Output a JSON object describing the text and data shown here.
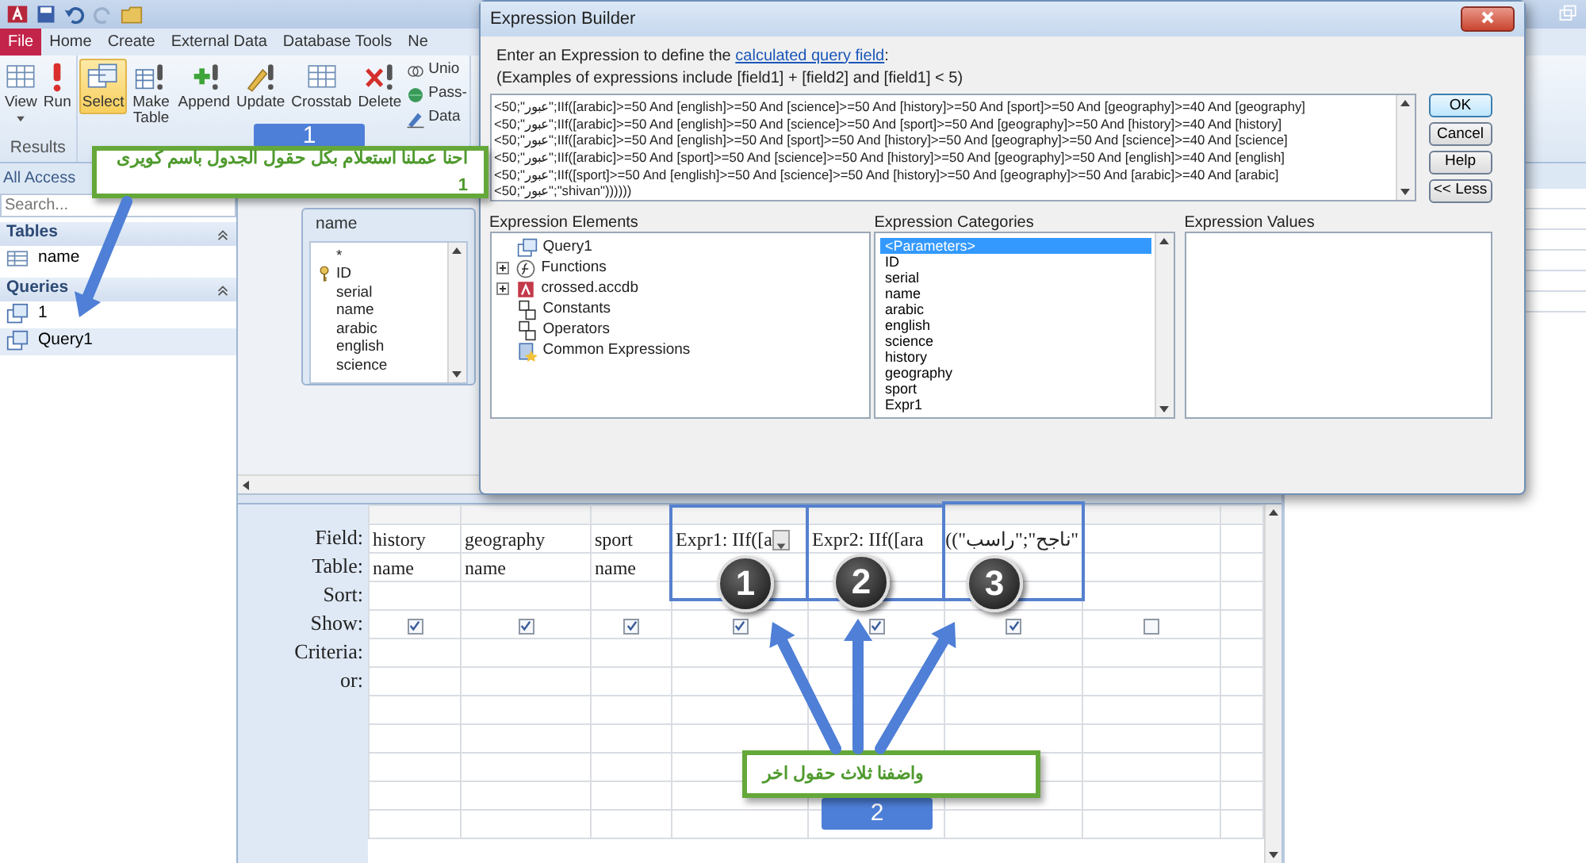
{
  "ribbon": {
    "tabs": [
      {
        "label": "File",
        "selected": true
      },
      {
        "label": "Home",
        "selected": false
      },
      {
        "label": "Create",
        "selected": false
      },
      {
        "label": "External Data",
        "selected": false
      },
      {
        "label": "Database Tools",
        "selected": false
      },
      {
        "label": "Ne",
        "selected": false
      }
    ],
    "groups": [
      {
        "label": "Results",
        "buttons": [
          {
            "label": "View",
            "selected": false,
            "kind": "dropdown"
          },
          {
            "label": "Run",
            "selected": false,
            "kind": "large"
          }
        ]
      },
      {
        "buttons": [
          {
            "label": "Select",
            "selected": true,
            "kind": "large"
          },
          {
            "label": "Make Table",
            "selected": false,
            "kind": "large"
          },
          {
            "label": "Append",
            "selected": false,
            "kind": "large"
          },
          {
            "label": "Update",
            "selected": false,
            "kind": "large"
          },
          {
            "label": "Crosstab",
            "selected": false,
            "kind": "large"
          },
          {
            "label": "Delete",
            "selected": false,
            "kind": "large"
          },
          {
            "label": "Unio",
            "selected": false,
            "kind": "small"
          },
          {
            "label": "Pass-",
            "selected": false,
            "kind": "small"
          },
          {
            "label": "Data",
            "selected": false,
            "kind": "small"
          }
        ]
      }
    ]
  },
  "nav_pane": {
    "header": "All Access",
    "search": {
      "placeholder": "Search..."
    },
    "sections": [
      {
        "title": "Tables",
        "items": [
          {
            "label": "name",
            "selected": false
          }
        ]
      },
      {
        "title": "Queries",
        "items": [
          {
            "label": "1",
            "selected": false
          },
          {
            "label": "Query1",
            "selected": true
          }
        ]
      }
    ]
  },
  "field_list": {
    "title": "name",
    "fields": [
      {
        "label": "*",
        "primary_key": false
      },
      {
        "label": "ID",
        "primary_key": true
      },
      {
        "label": "serial",
        "primary_key": false
      },
      {
        "label": "name",
        "primary_key": false
      },
      {
        "label": "arabic",
        "primary_key": false
      },
      {
        "label": "english",
        "primary_key": false
      },
      {
        "label": "science",
        "primary_key": false
      }
    ]
  },
  "grid": {
    "row_labels": [
      "Field:",
      "Table:",
      "Sort:",
      "Show:",
      "Criteria:",
      "or:"
    ],
    "columns": [
      {
        "field": "history",
        "table": "name",
        "show": true,
        "dropdown": false
      },
      {
        "field": "geography",
        "table": "name",
        "show": true,
        "dropdown": false
      },
      {
        "field": "sport",
        "table": "name",
        "show": true,
        "dropdown": false
      },
      {
        "field": "Expr1: IIf([a",
        "show": true,
        "dropdown": true
      },
      {
        "field": "Expr2: IIf([ara",
        "show": true,
        "dropdown": false
      },
      {
        "field": "\"ناجح\";\"راسب\"))",
        "show": true,
        "dropdown": false
      },
      {
        "show": false,
        "dropdown": false
      }
    ]
  },
  "dialog": {
    "title": "Expression Builder",
    "prompt": {
      "before": "Enter an Expression to define the ",
      "link": "calculated query field",
      "after": ":"
    },
    "examples": "(Examples of expressions include [field1] + [field2] and [field1] < 5)",
    "expression_lines": [
      "<50;\"عبور\";IIf([arabic]>=50 And [english]>=50 And [science]>=50 And [history]>=50 And [sport]>=50 And [geography]>=40 And [geography]",
      "<50;\"عبور\";IIf([arabic]>=50 And [english]>=50 And [science]>=50 And [sport]>=50 And [geography]>=50 And [history]>=40 And [history]",
      "<50;\"عبور\";IIf([arabic]>=50 And [english]>=50 And [sport]>=50 And [history]>=50 And [geography]>=50 And [science]>=40 And [science]",
      "<50;\"عبور\";IIf([arabic]>=50 And [sport]>=50 And [science]>=50 And [history]>=50 And [geography]>=50 And [english]>=40 And [english]",
      "<50;\"عبور\";IIf([sport]>=50 And [english]>=50 And [science]>=50 And [history]>=50 And [geography]>=50 And [arabic]>=40 And [arabic]",
      "<50;\"عبور\";\"shivan\"))))))"
    ],
    "buttons": [
      "OK",
      "Cancel",
      "Help",
      "<< Less"
    ],
    "elements": {
      "title": "Expression Elements",
      "items": [
        {
          "label": "Query1",
          "expandable": false
        },
        {
          "label": "Functions",
          "expandable": true
        },
        {
          "label": "crossed.accdb",
          "expandable": true
        },
        {
          "label": "Constants",
          "expandable": false
        },
        {
          "label": "Operators",
          "expandable": false
        },
        {
          "label": "Common Expressions",
          "expandable": false
        }
      ]
    },
    "categories": {
      "title": "Expression Categories",
      "items": [
        {
          "label": "<Parameters>",
          "selected": true
        },
        {
          "label": "ID",
          "selected": false
        },
        {
          "label": "serial",
          "selected": false
        },
        {
          "label": "name",
          "selected": false
        },
        {
          "label": "arabic",
          "selected": false
        },
        {
          "label": "english",
          "selected": false
        },
        {
          "label": "science",
          "selected": false
        },
        {
          "label": "history",
          "selected": false
        },
        {
          "label": "geography",
          "selected": false
        },
        {
          "label": "sport",
          "selected": false
        },
        {
          "label": "Expr1",
          "selected": false
        }
      ]
    },
    "values": {
      "title": "Expression Values"
    }
  },
  "annotations": {
    "callouts": [
      {
        "text": "احنا عملنا استعلام بكل حقول الجدول باسم كويرى 1",
        "badge": "1"
      },
      {
        "text": "واضفنا ثلاث حقول اخر",
        "badge": "2"
      }
    ],
    "markers": [
      "1",
      "2",
      "3"
    ]
  }
}
